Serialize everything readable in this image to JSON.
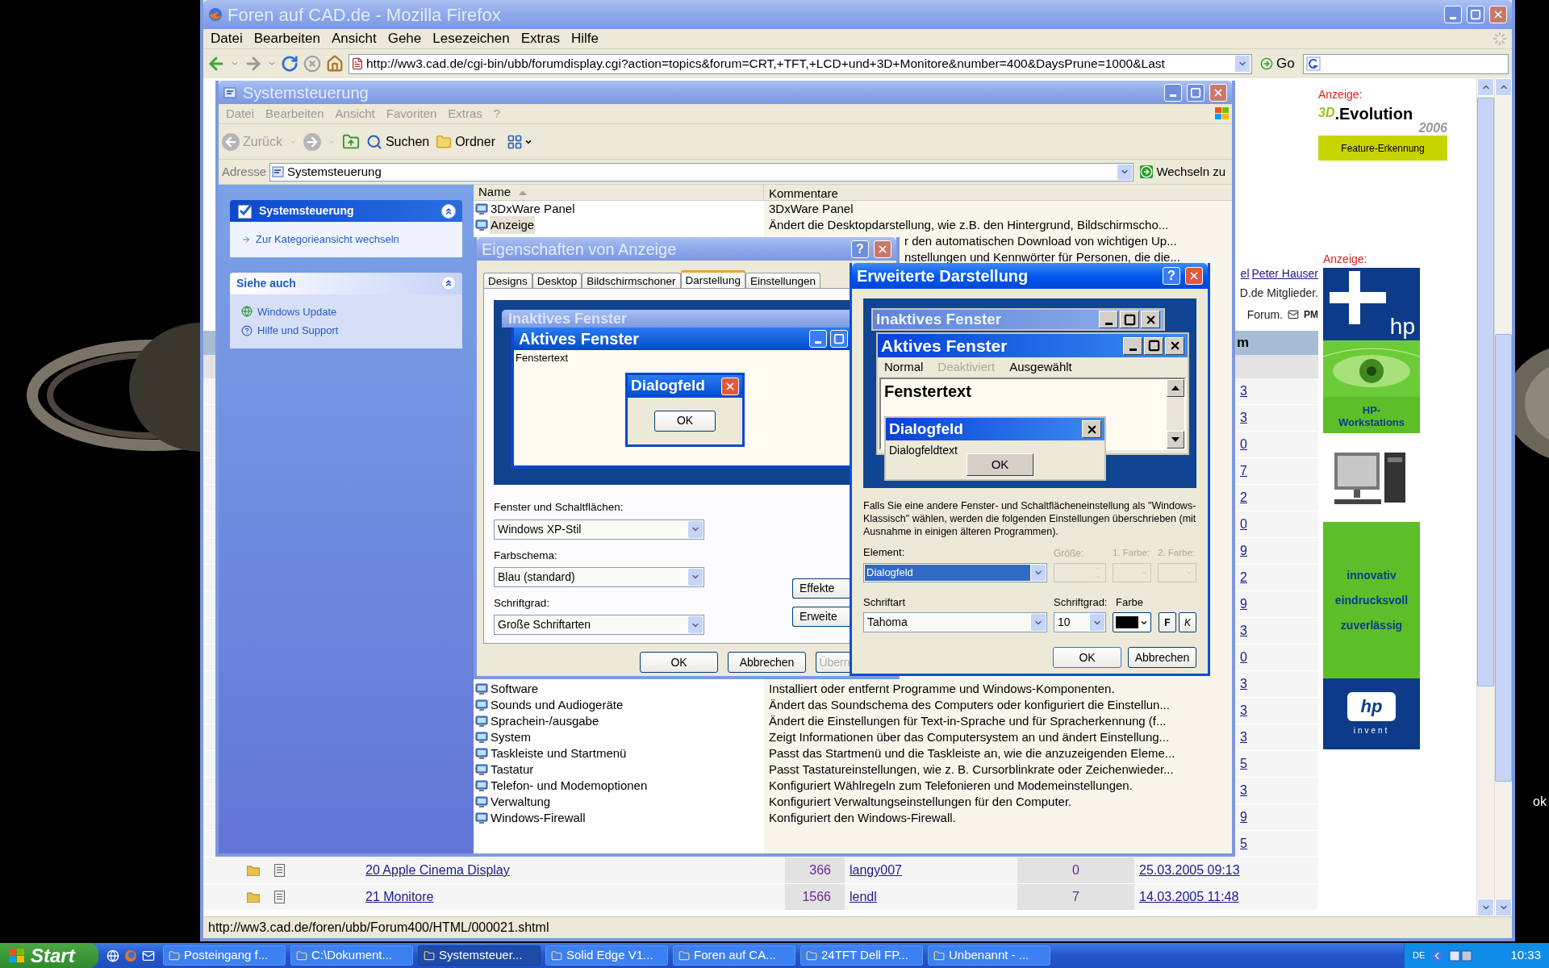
{
  "desktop": {
    "text": "ok"
  },
  "browser": {
    "title": "Foren auf CAD.de - Mozilla Firefox",
    "active": false,
    "menu": [
      "Datei",
      "Bearbeiten",
      "Ansicht",
      "Gehe",
      "Lesezeichen",
      "Extras",
      "Hilfe"
    ],
    "url": "http://ww3.cad.de/cgi-bin/ubb/forumdisplay.cgi?action=topics&forum=CRT,+TFT,+LCD+und+3D+Monitore&number=400&DaysPrune=1000&Last",
    "go": "Go",
    "page": {
      "moderator_fragments": [
        "el",
        "Peter Hauser"
      ],
      "info_fragments": [
        "D.de Mitglieder.",
        "Forum."
      ],
      "pm": "PM",
      "header_fragment": "m",
      "date_fragments": [
        "3",
        "3",
        "0",
        "7",
        "2",
        "0",
        "9",
        "2",
        "9",
        "3",
        "0",
        "3",
        "3",
        "3",
        "5",
        "3",
        "9",
        "5"
      ],
      "rows": [
        {
          "title": "20 Apple Cinema Display",
          "views": "366",
          "user": "langy007",
          "replies": "0",
          "date": "25.03.2005 09:13"
        },
        {
          "title": "21 Monitore",
          "views": "1566",
          "user": "lendl",
          "replies": "7",
          "date": "14.03.2005 11:48"
        }
      ]
    },
    "ads": {
      "label_1": "Anzeige:",
      "logo_prefix": "3D",
      "logo": ".Evolution",
      "logo_year": "2006",
      "logo_bar": "Feature-Erkennung",
      "label_2": "Anzeige:",
      "top_mark": "hp",
      "banner_title": "HP-Workstations",
      "banner_lines": [
        "innovativ",
        "eindrucksvoll",
        "zuverlässig"
      ],
      "bottom_mark": "hp",
      "bottom_tag": "invent"
    },
    "status": "http://ww3.cad.de/foren/ubb/Forum400/HTML/000021.shtml"
  },
  "control_panel": {
    "title": "Systemsteuerung",
    "active": false,
    "menu": [
      "Datei",
      "Bearbeiten",
      "Ansicht",
      "Favoriten",
      "Extras",
      "?"
    ],
    "toolbar": {
      "back": {
        "label": "Zurück",
        "disabled": true
      },
      "search": "Suchen",
      "folders": "Ordner"
    },
    "address_label": "Adresse",
    "address": "Systemsteuerung",
    "go": "Wechseln zu",
    "tasks": [
      {
        "kind": "primary",
        "title": "Systemsteuerung",
        "links": [
          "Zur Kategorieansicht wechseln"
        ]
      },
      {
        "kind": "secondary",
        "title": "Siehe auch",
        "links": [
          "Windows Update",
          "Hilfe und Support"
        ]
      }
    ],
    "columns": [
      "Name",
      "Kommentare"
    ],
    "rows_top": [
      {
        "name": "3DxWare Panel",
        "comment": "3DxWare Panel",
        "selected": false
      },
      {
        "name": "Anzeige",
        "comment": "Ändert die Desktopdarstellung, wie z.B. den Hintergrund, Bildschirmscho...",
        "selected": true
      }
    ],
    "comment_fragments": [
      "r den automatischen Download von wichtigen Up...",
      "nstellungen und Kennwörter für Personen, die die..."
    ],
    "rows_bottom": [
      {
        "name": "Software",
        "comment": "Installiert oder entfernt Programme und Windows-Komponenten."
      },
      {
        "name": "Sounds und Audiogeräte",
        "comment": "Ändert das Soundschema des Computers oder konfiguriert die Einstellun..."
      },
      {
        "name": "Sprachein-/ausgabe",
        "comment": "Ändert die Einstellungen für Text-in-Sprache und für Spracherkennung (f..."
      },
      {
        "name": "System",
        "comment": "Zeigt Informationen über das Computersystem an und ändert Einstellung..."
      },
      {
        "name": "Taskleiste und Startmenü",
        "comment": "Passt das Startmenü und die Taskleiste an, wie die anzuzeigenden Eleme..."
      },
      {
        "name": "Tastatur",
        "comment": "Passt Tastatureinstellungen, wie z. B. Cursorblinkrate oder Zeichenwieder..."
      },
      {
        "name": "Telefon- und Modemoptionen",
        "comment": "Konfiguriert Wählregeln zum Telefonieren und Modemeinstellungen."
      },
      {
        "name": "Verwaltung",
        "comment": "Konfiguriert Verwaltungseinstellungen für den Computer."
      },
      {
        "name": "Windows-Firewall",
        "comment": "Konfiguriert den Windows-Firewall."
      }
    ]
  },
  "display_properties": {
    "title": "Eigenschaften von Anzeige",
    "active": false,
    "help": "?",
    "tabs": [
      {
        "label": "Designs",
        "selected": false
      },
      {
        "label": "Desktop",
        "selected": false
      },
      {
        "label": "Bildschirmschoner",
        "selected": false
      },
      {
        "label": "Darstellung",
        "selected": true
      },
      {
        "label": "Einstellungen",
        "selected": false
      }
    ],
    "preview": {
      "inactive_title": "Inaktives Fenster",
      "active_title": "Aktives Fenster",
      "window_text": "Fenstertext",
      "dialog_title": "Dialogfeld",
      "ok": "OK"
    },
    "fields": [
      {
        "label": "Fenster und Schaltflächen:",
        "value": "Windows XP-Stil"
      },
      {
        "label": "Farbschema:",
        "value": "Blau (standard)"
      },
      {
        "label": "Schriftgrad:",
        "value": "Große Schriftarten"
      }
    ],
    "side_buttons": [
      "Effekte",
      "Erweite"
    ],
    "buttons": [
      {
        "label": "OK",
        "disabled": false
      },
      {
        "label": "Abbrechen",
        "disabled": false
      },
      {
        "label": "Übern",
        "disabled": true
      }
    ]
  },
  "advanced": {
    "title": "Erweiterte Darstellung",
    "active": true,
    "help": "?",
    "preview": {
      "inactive_title": "Inaktives Fenster",
      "active_title": "Aktives Fenster",
      "menu": [
        {
          "label": "Normal",
          "disabled": false
        },
        {
          "label": "Deaktiviert",
          "disabled": true
        },
        {
          "label": "Ausgewählt",
          "disabled": false
        }
      ],
      "window_text": "Fenstertext",
      "dialog_title": "Dialogfeld",
      "dialog_text": "Dialogfeldtext",
      "ok": "OK"
    },
    "note": "Falls Sie eine andere Fenster- und Schaltflächeneinstellung als \"Windows- Klassisch\" wählen, werden die folgenden Einstellungen überschrieben (mit Ausnahme in einigen älteren Programmen).",
    "element": {
      "label": "Element:",
      "value": "Dialogfeld"
    },
    "size": {
      "label": "Größe:",
      "disabled": true
    },
    "color_1": {
      "label": "1. Farbe:",
      "disabled": true
    },
    "color_2": {
      "label": "2. Farbe:",
      "disabled": true
    },
    "font": {
      "label": "Schriftart",
      "value": "Tahoma"
    },
    "font_size": {
      "label": "Schriftgrad:",
      "value": "10"
    },
    "font_color": {
      "label": "Farbe"
    },
    "bold": "F",
    "italic": "K",
    "buttons": [
      "OK",
      "Abbrechen"
    ]
  },
  "taskbar": {
    "start": "Start",
    "tasks": [
      {
        "label": "Posteingang f...",
        "selected": false
      },
      {
        "label": "C:\\Dokument...",
        "selected": false
      },
      {
        "label": "Systemsteuer...",
        "selected": true
      },
      {
        "label": "Solid Edge V1...",
        "selected": false
      },
      {
        "label": "Foren auf CA...",
        "selected": false
      },
      {
        "label": "24TFT Dell FP...",
        "selected": false
      },
      {
        "label": "Unbenannt - ...",
        "selected": false
      }
    ],
    "language": "DE",
    "clock": "10:33"
  }
}
